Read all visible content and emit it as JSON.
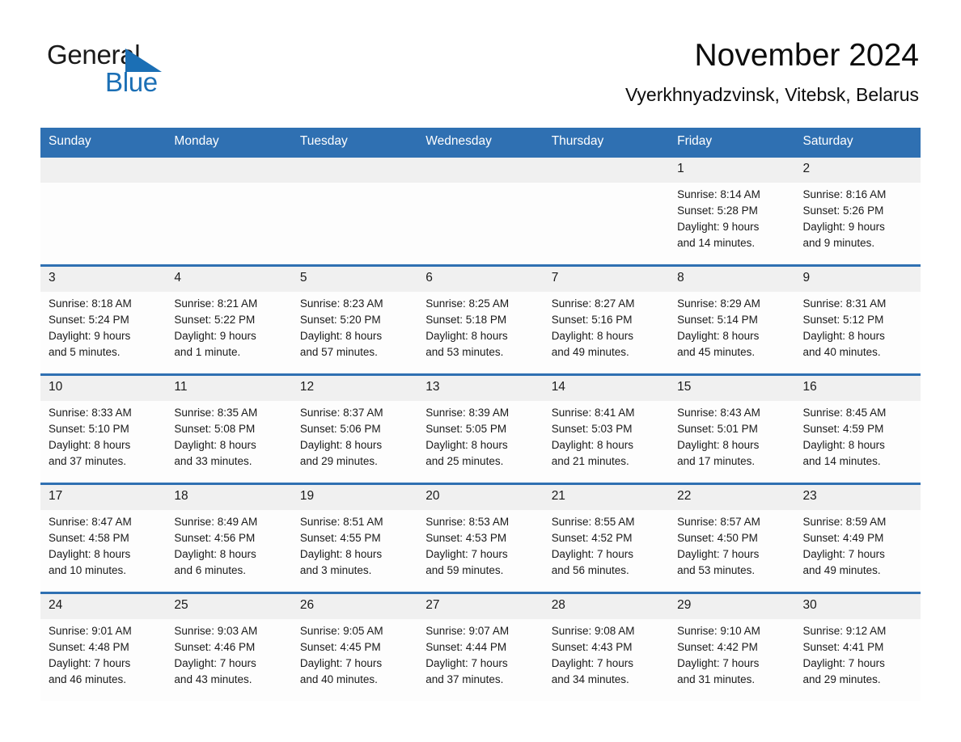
{
  "brand": {
    "name_part1": "General",
    "name_part2": "Blue",
    "logo_icon": "triangle-icon",
    "colors": {
      "blue": "#1b6fb5",
      "black": "#1a1a1a"
    }
  },
  "header": {
    "title": "November 2024",
    "subtitle": "Vyerkhnyadzvinsk, Vitebsk, Belarus"
  },
  "calendar": {
    "header_bg": "#2f70b2",
    "daynum_bg": "#f0f0f0",
    "weekdays": [
      "Sunday",
      "Monday",
      "Tuesday",
      "Wednesday",
      "Thursday",
      "Friday",
      "Saturday"
    ],
    "weeks": [
      {
        "days": [
          {
            "num": "",
            "lines": []
          },
          {
            "num": "",
            "lines": []
          },
          {
            "num": "",
            "lines": []
          },
          {
            "num": "",
            "lines": []
          },
          {
            "num": "",
            "lines": []
          },
          {
            "num": "1",
            "lines": [
              "Sunrise: 8:14 AM",
              "Sunset: 5:28 PM",
              "Daylight: 9 hours",
              "and 14 minutes."
            ]
          },
          {
            "num": "2",
            "lines": [
              "Sunrise: 8:16 AM",
              "Sunset: 5:26 PM",
              "Daylight: 9 hours",
              "and 9 minutes."
            ]
          }
        ]
      },
      {
        "days": [
          {
            "num": "3",
            "lines": [
              "Sunrise: 8:18 AM",
              "Sunset: 5:24 PM",
              "Daylight: 9 hours",
              "and 5 minutes."
            ]
          },
          {
            "num": "4",
            "lines": [
              "Sunrise: 8:21 AM",
              "Sunset: 5:22 PM",
              "Daylight: 9 hours",
              "and 1 minute."
            ]
          },
          {
            "num": "5",
            "lines": [
              "Sunrise: 8:23 AM",
              "Sunset: 5:20 PM",
              "Daylight: 8 hours",
              "and 57 minutes."
            ]
          },
          {
            "num": "6",
            "lines": [
              "Sunrise: 8:25 AM",
              "Sunset: 5:18 PM",
              "Daylight: 8 hours",
              "and 53 minutes."
            ]
          },
          {
            "num": "7",
            "lines": [
              "Sunrise: 8:27 AM",
              "Sunset: 5:16 PM",
              "Daylight: 8 hours",
              "and 49 minutes."
            ]
          },
          {
            "num": "8",
            "lines": [
              "Sunrise: 8:29 AM",
              "Sunset: 5:14 PM",
              "Daylight: 8 hours",
              "and 45 minutes."
            ]
          },
          {
            "num": "9",
            "lines": [
              "Sunrise: 8:31 AM",
              "Sunset: 5:12 PM",
              "Daylight: 8 hours",
              "and 40 minutes."
            ]
          }
        ]
      },
      {
        "days": [
          {
            "num": "10",
            "lines": [
              "Sunrise: 8:33 AM",
              "Sunset: 5:10 PM",
              "Daylight: 8 hours",
              "and 37 minutes."
            ]
          },
          {
            "num": "11",
            "lines": [
              "Sunrise: 8:35 AM",
              "Sunset: 5:08 PM",
              "Daylight: 8 hours",
              "and 33 minutes."
            ]
          },
          {
            "num": "12",
            "lines": [
              "Sunrise: 8:37 AM",
              "Sunset: 5:06 PM",
              "Daylight: 8 hours",
              "and 29 minutes."
            ]
          },
          {
            "num": "13",
            "lines": [
              "Sunrise: 8:39 AM",
              "Sunset: 5:05 PM",
              "Daylight: 8 hours",
              "and 25 minutes."
            ]
          },
          {
            "num": "14",
            "lines": [
              "Sunrise: 8:41 AM",
              "Sunset: 5:03 PM",
              "Daylight: 8 hours",
              "and 21 minutes."
            ]
          },
          {
            "num": "15",
            "lines": [
              "Sunrise: 8:43 AM",
              "Sunset: 5:01 PM",
              "Daylight: 8 hours",
              "and 17 minutes."
            ]
          },
          {
            "num": "16",
            "lines": [
              "Sunrise: 8:45 AM",
              "Sunset: 4:59 PM",
              "Daylight: 8 hours",
              "and 14 minutes."
            ]
          }
        ]
      },
      {
        "days": [
          {
            "num": "17",
            "lines": [
              "Sunrise: 8:47 AM",
              "Sunset: 4:58 PM",
              "Daylight: 8 hours",
              "and 10 minutes."
            ]
          },
          {
            "num": "18",
            "lines": [
              "Sunrise: 8:49 AM",
              "Sunset: 4:56 PM",
              "Daylight: 8 hours",
              "and 6 minutes."
            ]
          },
          {
            "num": "19",
            "lines": [
              "Sunrise: 8:51 AM",
              "Sunset: 4:55 PM",
              "Daylight: 8 hours",
              "and 3 minutes."
            ]
          },
          {
            "num": "20",
            "lines": [
              "Sunrise: 8:53 AM",
              "Sunset: 4:53 PM",
              "Daylight: 7 hours",
              "and 59 minutes."
            ]
          },
          {
            "num": "21",
            "lines": [
              "Sunrise: 8:55 AM",
              "Sunset: 4:52 PM",
              "Daylight: 7 hours",
              "and 56 minutes."
            ]
          },
          {
            "num": "22",
            "lines": [
              "Sunrise: 8:57 AM",
              "Sunset: 4:50 PM",
              "Daylight: 7 hours",
              "and 53 minutes."
            ]
          },
          {
            "num": "23",
            "lines": [
              "Sunrise: 8:59 AM",
              "Sunset: 4:49 PM",
              "Daylight: 7 hours",
              "and 49 minutes."
            ]
          }
        ]
      },
      {
        "days": [
          {
            "num": "24",
            "lines": [
              "Sunrise: 9:01 AM",
              "Sunset: 4:48 PM",
              "Daylight: 7 hours",
              "and 46 minutes."
            ]
          },
          {
            "num": "25",
            "lines": [
              "Sunrise: 9:03 AM",
              "Sunset: 4:46 PM",
              "Daylight: 7 hours",
              "and 43 minutes."
            ]
          },
          {
            "num": "26",
            "lines": [
              "Sunrise: 9:05 AM",
              "Sunset: 4:45 PM",
              "Daylight: 7 hours",
              "and 40 minutes."
            ]
          },
          {
            "num": "27",
            "lines": [
              "Sunrise: 9:07 AM",
              "Sunset: 4:44 PM",
              "Daylight: 7 hours",
              "and 37 minutes."
            ]
          },
          {
            "num": "28",
            "lines": [
              "Sunrise: 9:08 AM",
              "Sunset: 4:43 PM",
              "Daylight: 7 hours",
              "and 34 minutes."
            ]
          },
          {
            "num": "29",
            "lines": [
              "Sunrise: 9:10 AM",
              "Sunset: 4:42 PM",
              "Daylight: 7 hours",
              "and 31 minutes."
            ]
          },
          {
            "num": "30",
            "lines": [
              "Sunrise: 9:12 AM",
              "Sunset: 4:41 PM",
              "Daylight: 7 hours",
              "and 29 minutes."
            ]
          }
        ]
      }
    ]
  }
}
